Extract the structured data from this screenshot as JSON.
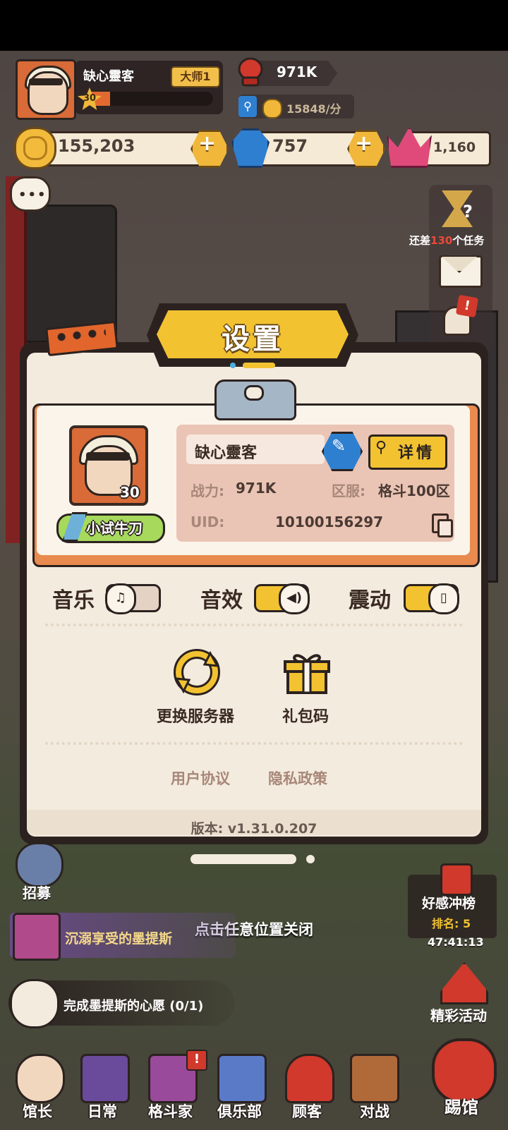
{
  "hud": {
    "player_name": "缺心靈客",
    "rank_badge": "大师1",
    "level": "30",
    "xp_fraction": 0.2,
    "power": "971K",
    "income": "15848/分",
    "gold": "155,203",
    "gems": "757",
    "hearts": "1,160",
    "task_prefix": "还差",
    "task_count": "130",
    "task_suffix": "个任务"
  },
  "dialog": {
    "title": "设置",
    "profile": {
      "name": "缺心靈客",
      "level": "30",
      "title_tag": "小试牛刀",
      "detail_button": "详情",
      "power_label": "战力:",
      "power_value": "971K",
      "server_label": "区服:",
      "server_value": "格斗100区",
      "uid_label": "UID:",
      "uid_value": "10100156297"
    },
    "toggles": [
      {
        "label": "音乐",
        "on": false
      },
      {
        "label": "音效",
        "on": true
      },
      {
        "label": "震动",
        "on": true
      }
    ],
    "actions": {
      "change_server": "更换服务器",
      "gift_code": "礼包码"
    },
    "links": {
      "user_agreement": "用户协议",
      "privacy_policy": "隐私政策"
    },
    "version": "版本: v1.31.0.207"
  },
  "close_hint": "点击任意位置关闭",
  "side": {
    "recruit": "招募",
    "quest_text": "沉溺享受的墨提斯",
    "wish_text": "完成墨提斯的心愿 (0/1)",
    "event_title": "好感冲榜",
    "event_rank": "排名: 5",
    "event_timer": "47:41:13",
    "events_label": "精彩活动"
  },
  "nav": {
    "items": [
      "馆长",
      "日常",
      "格斗家",
      "俱乐部",
      "顾客",
      "对战"
    ],
    "kick": "踢馆",
    "alert_badge": "!"
  },
  "colors": {
    "accent_yellow": "#f2c231",
    "accent_orange": "#e98a4e",
    "panel_bg": "#f3ebde",
    "dark_outline": "#2b2220"
  }
}
